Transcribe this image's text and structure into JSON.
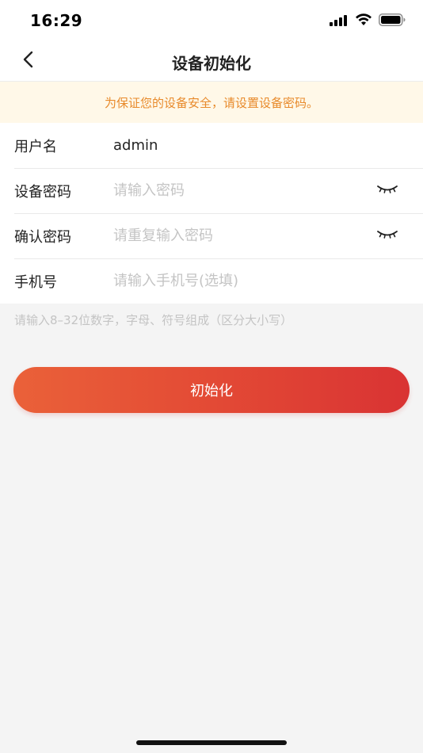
{
  "status_bar": {
    "time": "16:29"
  },
  "nav": {
    "title": "设备初始化"
  },
  "notice": {
    "text": "为保证您的设备安全，请设置设备密码。",
    "color": "#e88a2b"
  },
  "form": {
    "username": {
      "label": "用户名",
      "value": "admin"
    },
    "password": {
      "label": "设备密码",
      "placeholder": "请输入密码"
    },
    "confirm_password": {
      "label": "确认密码",
      "placeholder": "请重复输入密码"
    },
    "phone": {
      "label": "手机号",
      "placeholder": "请输入手机号(选填)"
    }
  },
  "hint": "请输入8–32位数字，字母、符号组成（区分大小写）",
  "submit": {
    "label": "初始化",
    "gradient_start": "#ea6139",
    "gradient_end": "#d93333"
  },
  "icons": {
    "back": "chevron-left-icon",
    "eye_closed": "eye-closed-icon",
    "signal": "signal-icon",
    "wifi": "wifi-icon",
    "battery": "battery-icon"
  }
}
